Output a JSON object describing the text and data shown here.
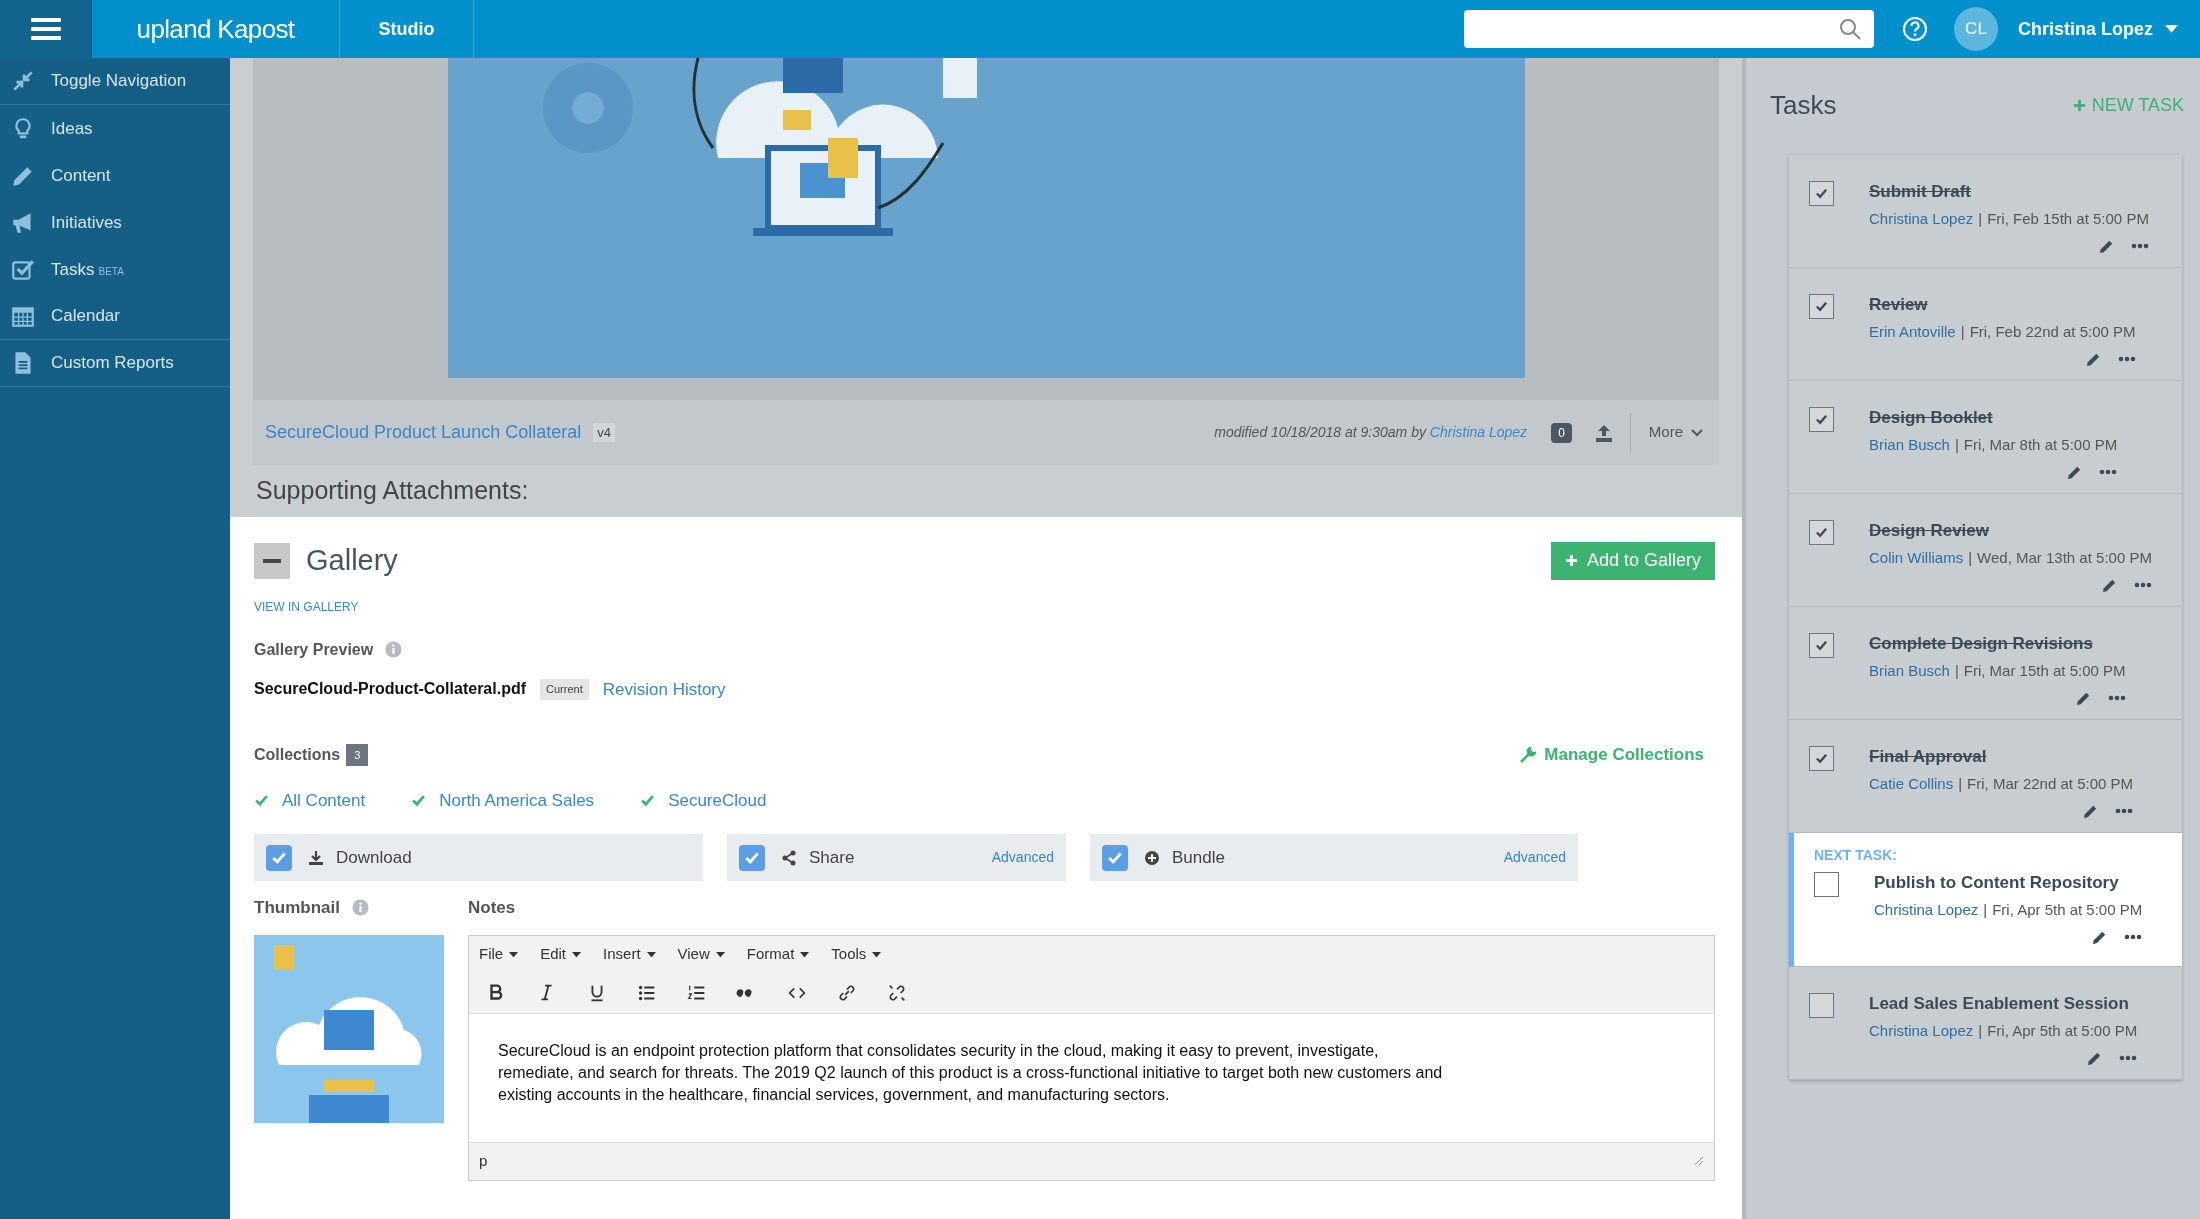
{
  "topbar": {
    "logo": "upland Kapost",
    "section": "Studio",
    "user": {
      "initials": "CL",
      "name": "Christina Lopez"
    }
  },
  "sidebar": {
    "items": [
      {
        "label": "Toggle Navigation"
      },
      {
        "label": "Ideas"
      },
      {
        "label": "Content"
      },
      {
        "label": "Initiatives"
      },
      {
        "label": "Tasks",
        "badge": "BETA"
      },
      {
        "label": "Calendar"
      },
      {
        "label": "Custom Reports"
      }
    ]
  },
  "document": {
    "title": "SecureCloud Product Launch Collateral",
    "version": "v4",
    "modified": "modified 10/18/2018 at 9:30am by",
    "modified_by": "Christina Lopez",
    "comments": "0",
    "more": "More"
  },
  "section_title": "Supporting Attachments:",
  "gallery": {
    "title": "Gallery",
    "add_button": "Add to Gallery",
    "view_link": "VIEW IN GALLERY",
    "preview_label": "Gallery Preview",
    "file_name": "SecureCloud-Product-Collateral.pdf",
    "file_badge": "Current",
    "revision_link": "Revision History",
    "collections_label": "Collections",
    "collections_count": "3",
    "manage": "Manage Collections",
    "collections": [
      {
        "label": "All Content"
      },
      {
        "label": "North America Sales"
      },
      {
        "label": "SecureCloud"
      }
    ],
    "options": [
      {
        "label": "Download",
        "checked": true
      },
      {
        "label": "Share",
        "checked": true,
        "advanced": "Advanced"
      },
      {
        "label": "Bundle",
        "checked": true,
        "advanced": "Advanced"
      }
    ],
    "thumbnail_label": "Thumbnail",
    "notes_label": "Notes",
    "editor": {
      "menus": [
        "File",
        "Edit",
        "Insert",
        "View",
        "Format",
        "Tools"
      ],
      "text": "SecureCloud is an endpoint protection platform that consolidates security in the cloud, making it easy to prevent, investigate, remediate, and search for threats. The 2019 Q2 launch of this product is a cross-functional initiative to target both new customers and existing accounts in the healthcare, financial services, government, and manufacturing sectors.",
      "status": "p"
    }
  },
  "tasks": {
    "title": "Tasks",
    "new_task": "NEW TASK",
    "items": [
      {
        "title": "Submit Draft",
        "assignee": "Christina Lopez",
        "separator": "|",
        "due": "Fri, Feb 15th at 5:00 PM",
        "done": true,
        "highlighted": false
      },
      {
        "title": "Review",
        "assignee": "Erin Antoville",
        "separator": "|",
        "due": "Fri, Feb 22nd at 5:00 PM",
        "done": true,
        "highlighted": false
      },
      {
        "title": "Design Booklet",
        "assignee": "Brian Busch",
        "separator": "|",
        "due": "Fri, Mar 8th at 5:00 PM",
        "done": true,
        "highlighted": false
      },
      {
        "title": "Design Review",
        "assignee": "Colin Williams",
        "separator": "|",
        "due": "Wed, Mar 13th at 5:00 PM",
        "done": true,
        "highlighted": false
      },
      {
        "title": "Complete Design Revisions",
        "assignee": "Brian Busch",
        "separator": "|",
        "due": "Fri, Mar 15th at 5:00 PM",
        "done": true,
        "highlighted": false
      },
      {
        "title": "Final Approval",
        "assignee": "Catie Collins",
        "separator": "|",
        "due": "Fri, Mar 22nd at 5:00 PM",
        "done": true,
        "highlighted": false
      },
      {
        "title": "Publish to Content Repository",
        "assignee": "Christina Lopez",
        "separator": "|",
        "due": "Fri, Apr 5th at 5:00 PM",
        "done": false,
        "highlighted": true,
        "label": "NEXT TASK:"
      },
      {
        "title": "Lead Sales Enablement Session",
        "assignee": "Christina Lopez",
        "separator": "|",
        "due": "Fri, Apr 5th at 5:00 PM",
        "done": false,
        "highlighted": false
      }
    ]
  }
}
